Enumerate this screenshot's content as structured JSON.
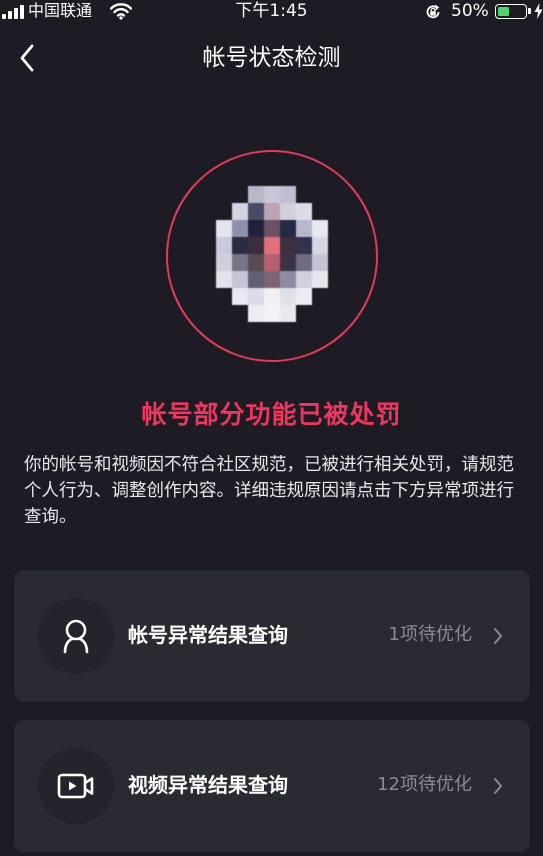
{
  "status_bar": {
    "carrier": "中国联通",
    "time": "下午1:45",
    "battery_percent": "50%",
    "battery_level": 0.5,
    "battery_color": "#4cd964"
  },
  "nav": {
    "back_icon": "chevron-left-icon",
    "title": "帐号状态检测"
  },
  "profile": {
    "ring_color": "#e63a5a",
    "mosaic": [
      [
        null,
        null,
        "#b9b8cb",
        "#c9c6d6",
        "#bfbed0",
        null,
        null
      ],
      [
        null,
        "#d4d3e2",
        "#474a67",
        "#bca3b2",
        "#d2d0dd",
        "#dddce8",
        null
      ],
      [
        "#e4e4ee",
        "#8e90ae",
        "#20223a",
        "#6a5266",
        "#272a44",
        "#b7b8ce",
        "#e8e8f0"
      ],
      [
        "#c8c9da",
        "#2a2c42",
        "#3a2e3c",
        "#e2707c",
        "#3a3040",
        "#303350",
        "#d6d6e4"
      ],
      [
        "#cfcfdc",
        "#7a7488",
        "#5a4850",
        "#b86070",
        "#3c3446",
        "#6e6a80",
        "#c4c4d4"
      ],
      [
        "#e2e2ec",
        "#c6c4d4",
        "#606078",
        "#7c6474",
        "#8e8ca2",
        "#d2d0de",
        "#e6e6f0"
      ],
      [
        null,
        "#e8e8f2",
        "#dcdce8",
        "#f0eef6",
        "#e0e0ea",
        "#ececf4",
        null
      ],
      [
        null,
        null,
        "#ececf6",
        "#f4f2f8",
        "#e8e8f2",
        null,
        null
      ]
    ]
  },
  "warning": {
    "title": "帐号部分功能已被处罚",
    "title_color": "#f0365c",
    "description": "你的帐号和视频因不符合社区规范，已被进行相关处罚，请规范个人行为、调整创作内容。详细违规原因请点击下方异常项进行查询。"
  },
  "cards": [
    {
      "icon": "user-icon",
      "label": "帐号异常结果查询",
      "status": "1项待优化",
      "chevron": "chevron-right-icon"
    },
    {
      "icon": "video-icon",
      "label": "视频异常结果查询",
      "status": "12项待优化",
      "chevron": "chevron-right-icon"
    }
  ]
}
